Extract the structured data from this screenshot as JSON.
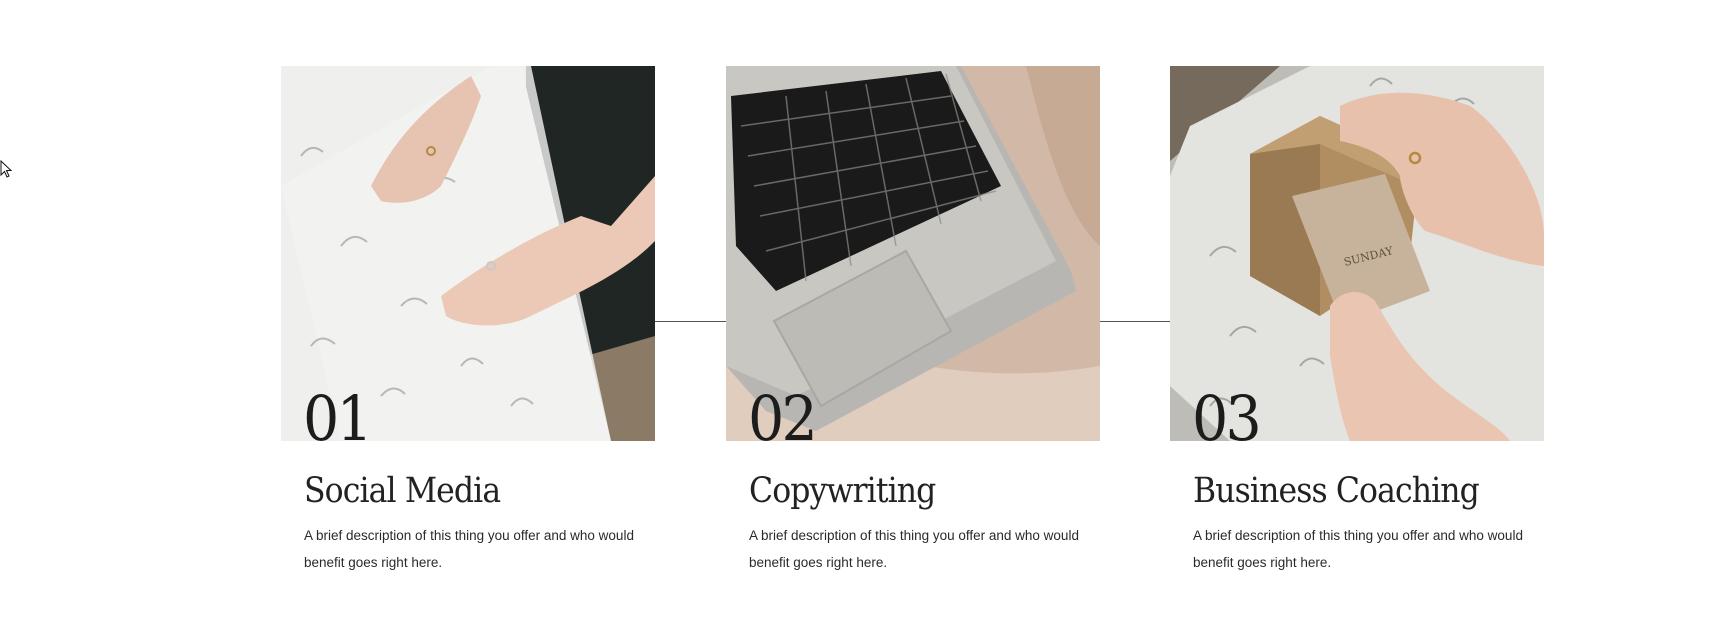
{
  "services": [
    {
      "number": "01",
      "title": "Social Media",
      "description": "A brief description of this thing you offer and who would benefit goes right here.",
      "image_icon": "tissue-paper-hands-image"
    },
    {
      "number": "02",
      "title": "Copywriting",
      "description": "A brief description of this thing you offer and who would benefit goes right here.",
      "image_icon": "laptop-keyboard-image"
    },
    {
      "number": "03",
      "title": "Business Coaching",
      "description": "A brief description of this thing you offer and who would benefit goes right here.",
      "image_icon": "gift-box-card-image"
    }
  ],
  "colors": {
    "text_dark": "#1c1c1c",
    "connector": "#555555",
    "background": "#ffffff"
  }
}
